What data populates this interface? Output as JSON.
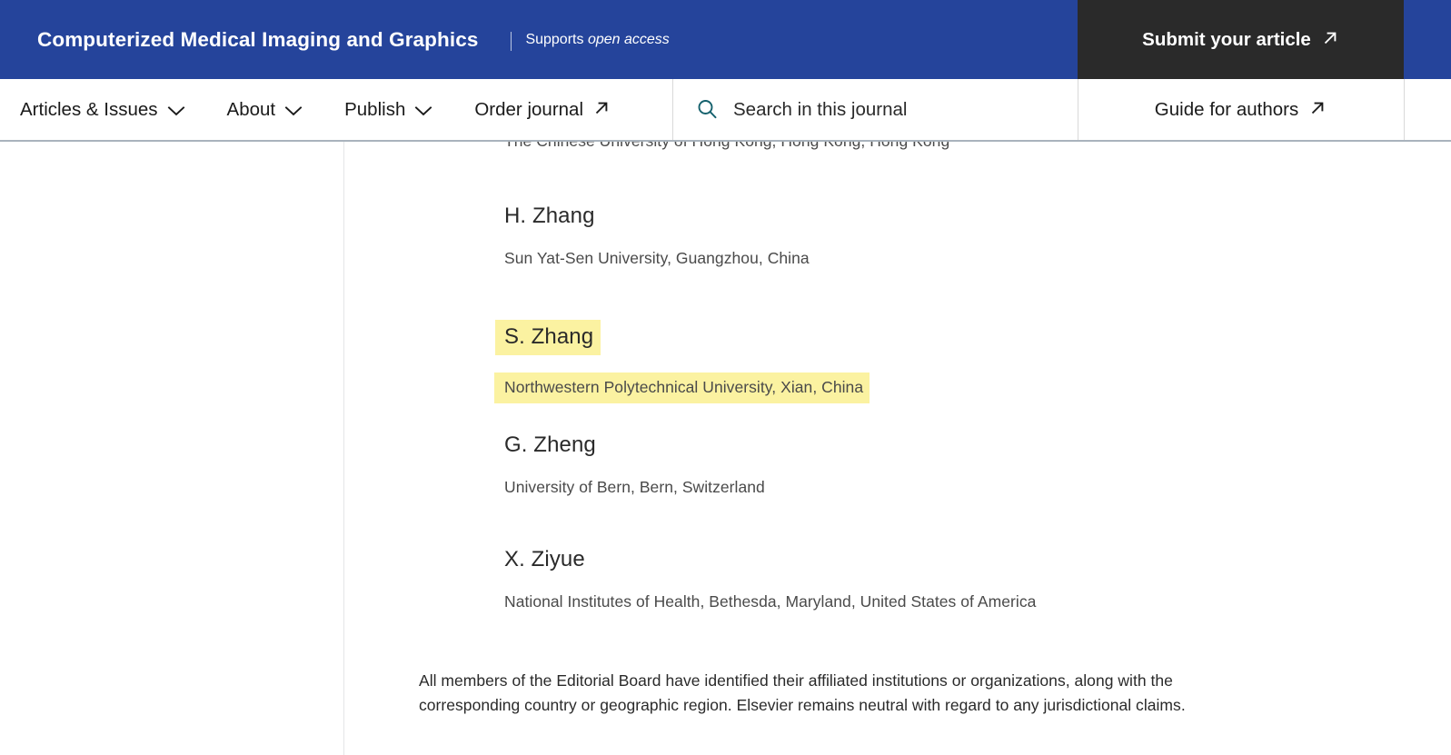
{
  "journal_header": {
    "title": "Computerized Medical Imaging and Graphics",
    "supports_label": "Supports",
    "open_access_label": "open access",
    "submit_button": "Submit your article",
    "bar_color": "#25449B",
    "submit_button_color": "#2A2A2A"
  },
  "nav": {
    "items": [
      {
        "label": "Articles & Issues",
        "icon": "chevron-down-icon"
      },
      {
        "label": "About",
        "icon": "chevron-down-icon"
      },
      {
        "label": "Publish",
        "icon": "chevron-down-icon"
      },
      {
        "label": "Order journal",
        "icon": "arrow-up-right-icon"
      }
    ],
    "search": {
      "icon": "search-icon",
      "placeholder": "Search in this journal",
      "value": "",
      "icon_color": "#15616D"
    },
    "guide_for_authors": {
      "label": "Guide for authors",
      "icon": "arrow-up-right-icon"
    }
  },
  "content": {
    "clipped_affiliation": "The Chinese University of Hong Kong, Hong Kong, Hong Kong",
    "highlight_color": "#FBF2A1",
    "editorial_board": [
      {
        "name": "H. Zhang",
        "affiliation": "Sun Yat-Sen University, Guangzhou, China",
        "highlighted": false
      },
      {
        "name": "S. Zhang",
        "affiliation": "Northwestern Polytechnical University, Xian, China",
        "highlighted": true
      },
      {
        "name": "G. Zheng",
        "affiliation": "University of Bern, Bern, Switzerland",
        "highlighted": false
      },
      {
        "name": "X. Ziyue",
        "affiliation": "National Institutes of Health, Bethesda, Maryland, United States of America",
        "highlighted": false
      }
    ],
    "disclaimer": "All members of the Editorial Board have identified their affiliated institutions or organizations, along with the corresponding country or geographic region. Elsevier remains neutral with regard to any jurisdictional claims."
  }
}
